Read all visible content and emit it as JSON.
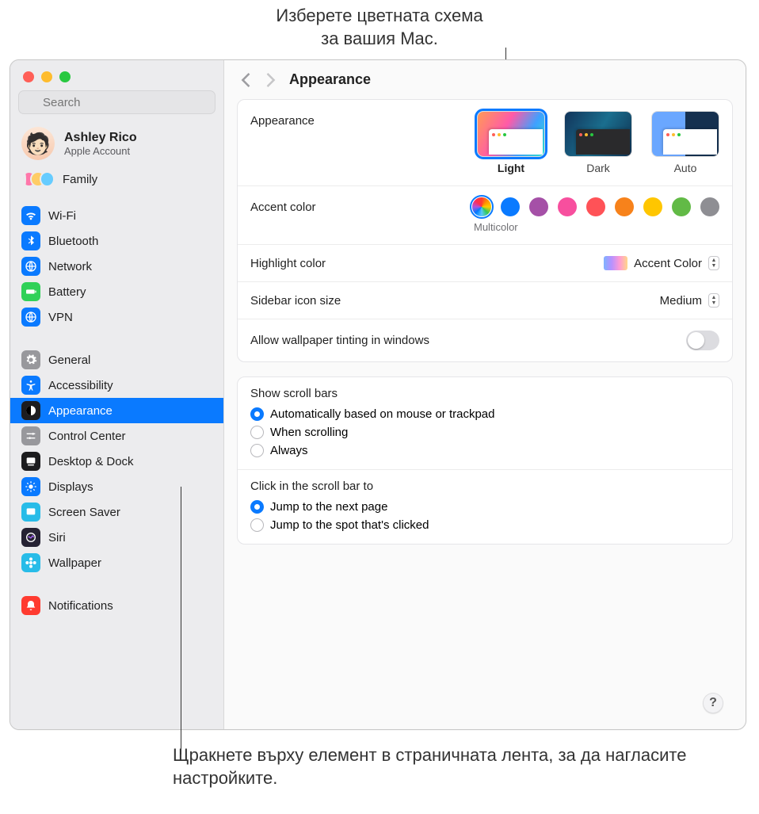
{
  "callouts": {
    "top": "Изберете цветната схема за вашия Mac.",
    "bottom": "Щракнете върху елемент в страничната лента, за да нагласите настройките."
  },
  "search": {
    "placeholder": "Search"
  },
  "account": {
    "name": "Ashley Rico",
    "sub": "Apple Account"
  },
  "family": {
    "label": "Family"
  },
  "sidebar": {
    "group1": [
      {
        "label": "Wi-Fi",
        "color": "#0a7aff",
        "icon": "wifi"
      },
      {
        "label": "Bluetooth",
        "color": "#0a7aff",
        "icon": "bluetooth"
      },
      {
        "label": "Network",
        "color": "#0a7aff",
        "icon": "globe"
      },
      {
        "label": "Battery",
        "color": "#30d158",
        "icon": "battery"
      },
      {
        "label": "VPN",
        "color": "#0a7aff",
        "icon": "globe"
      }
    ],
    "group2": [
      {
        "label": "General",
        "color": "#98989c",
        "icon": "gear"
      },
      {
        "label": "Accessibility",
        "color": "#0a7aff",
        "icon": "accessibility"
      },
      {
        "label": "Appearance",
        "color": "#1c1c1e",
        "icon": "appearance",
        "selected": true
      },
      {
        "label": "Control Center",
        "color": "#98989c",
        "icon": "sliders"
      },
      {
        "label": "Desktop & Dock",
        "color": "#1c1c1e",
        "icon": "dock"
      },
      {
        "label": "Displays",
        "color": "#0a7aff",
        "icon": "brightness"
      },
      {
        "label": "Screen Saver",
        "color": "#28bce8",
        "icon": "screensaver"
      },
      {
        "label": "Siri",
        "color": "#252233",
        "icon": "siri"
      },
      {
        "label": "Wallpaper",
        "color": "#28bce8",
        "icon": "flower"
      }
    ],
    "group3": [
      {
        "label": "Notifications",
        "color": "#ff3b30",
        "icon": "bell"
      }
    ]
  },
  "header": {
    "title": "Appearance"
  },
  "appearance": {
    "label": "Appearance",
    "options": [
      {
        "label": "Light",
        "selected": true
      },
      {
        "label": "Dark",
        "selected": false
      },
      {
        "label": "Auto",
        "selected": false
      }
    ]
  },
  "accent": {
    "label": "Accent color",
    "sub": "Multicolor",
    "colors": [
      "multicolor",
      "#0a7aff",
      "#a550a7",
      "#f74f9e",
      "#ff5257",
      "#f7821b",
      "#ffc600",
      "#62ba46",
      "#8e8e93"
    ]
  },
  "highlight": {
    "label": "Highlight color",
    "value": "Accent Color"
  },
  "sidebarSize": {
    "label": "Sidebar icon size",
    "value": "Medium"
  },
  "tinting": {
    "label": "Allow wallpaper tinting in windows",
    "on": false
  },
  "scrollbars": {
    "title": "Show scroll bars",
    "options": [
      {
        "label": "Automatically based on mouse or trackpad",
        "checked": true
      },
      {
        "label": "When scrolling",
        "checked": false
      },
      {
        "label": "Always",
        "checked": false
      }
    ]
  },
  "scrollclick": {
    "title": "Click in the scroll bar to",
    "options": [
      {
        "label": "Jump to the next page",
        "checked": true
      },
      {
        "label": "Jump to the spot that's clicked",
        "checked": false
      }
    ]
  },
  "help": "?"
}
